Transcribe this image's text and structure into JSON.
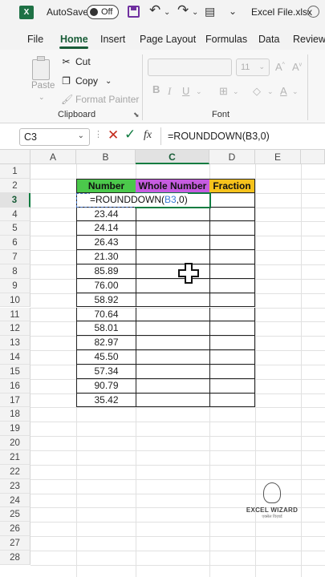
{
  "titlebar": {
    "logo": "X",
    "autosave_label": "AutoSave",
    "autosave_state": "Off",
    "file_title": "Excel File.xlsx",
    "account_initial": "C"
  },
  "tabs": [
    "File",
    "Home",
    "Insert",
    "Page Layout",
    "Formulas",
    "Data",
    "Review"
  ],
  "active_tab": "Home",
  "ribbon": {
    "paste_label": "Paste",
    "cut_label": "Cut",
    "copy_label": "Copy",
    "format_painter_label": "Format Painter",
    "clipboard_group": "Clipboard",
    "font_group": "Font",
    "font_size": "11",
    "bold": "B"
  },
  "formula_bar": {
    "name_box": "C3",
    "fx": "fx",
    "content": "=ROUNDDOWN(B3,0)"
  },
  "columns": [
    "A",
    "B",
    "C",
    "D",
    "E"
  ],
  "selected_column": "C",
  "rows": [
    "1",
    "2",
    "3",
    "4",
    "5",
    "6",
    "7",
    "8",
    "9",
    "10",
    "11",
    "12",
    "13",
    "14",
    "15",
    "16",
    "17",
    "18",
    "19",
    "20",
    "21",
    "22",
    "23",
    "24",
    "25",
    "26",
    "27",
    "28"
  ],
  "selected_row": "3",
  "table": {
    "headers": [
      "Number",
      "Whole Number",
      "Fraction"
    ],
    "header_colors": [
      "#4bc84b",
      "#c65ce0",
      "#f6c21c"
    ],
    "editing_formula_prefix": "=ROUNDDOWN(",
    "editing_formula_ref": "B3",
    "editing_formula_suffix": ",0)",
    "numbers": [
      "23.44",
      "24.14",
      "26.43",
      "21.30",
      "85.89",
      "76.00",
      "58.92",
      "70.64",
      "58.01",
      "82.97",
      "45.50",
      "57.34",
      "90.79",
      "35.42"
    ]
  },
  "watermark": {
    "title": "EXCEL WIZARD",
    "subtitle": "एक्सेल विज़ार्ड"
  },
  "colors": {
    "excel_green": "#107c41",
    "accent_purple": "#7030a0"
  }
}
